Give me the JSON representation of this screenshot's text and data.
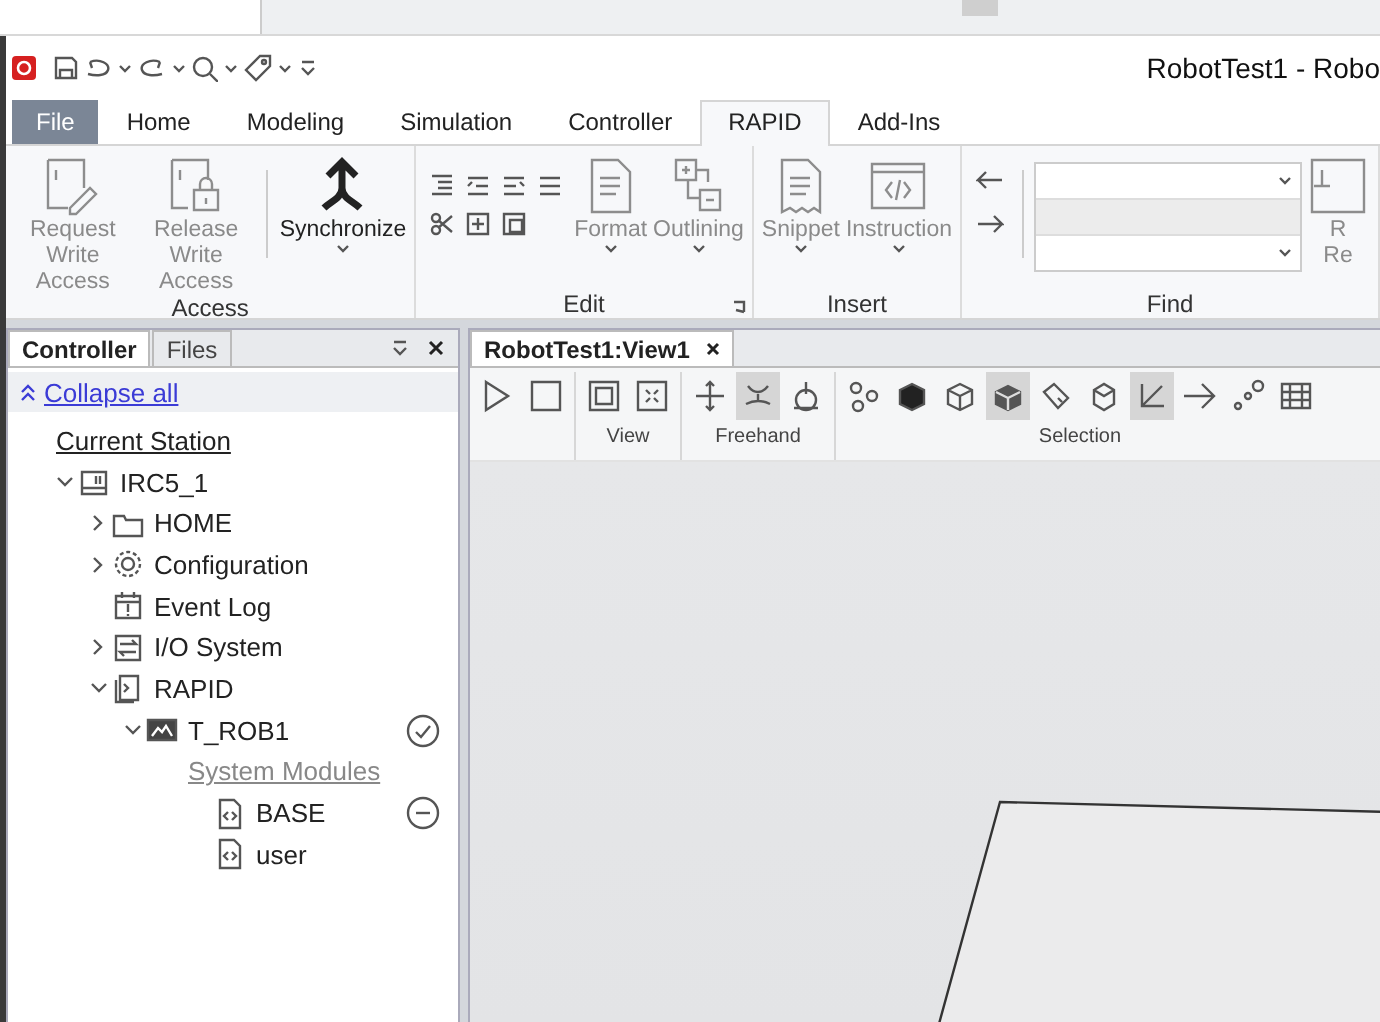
{
  "window": {
    "title": "RobotTest1 - Robo"
  },
  "menu_tabs": [
    {
      "label": "File",
      "kind": "file",
      "selected": false
    },
    {
      "label": "Home",
      "kind": "tab",
      "selected": false
    },
    {
      "label": "Modeling",
      "kind": "tab",
      "selected": false
    },
    {
      "label": "Simulation",
      "kind": "tab",
      "selected": false
    },
    {
      "label": "Controller",
      "kind": "tab",
      "selected": false
    },
    {
      "label": "RAPID",
      "kind": "tab",
      "selected": true
    },
    {
      "label": "Add-Ins",
      "kind": "tab",
      "selected": false
    }
  ],
  "ribbon_groups": [
    {
      "label": "Access",
      "items": [
        {
          "kind": "large",
          "label": "Request Write Access",
          "disabled": true,
          "dropdown": false
        },
        {
          "kind": "large",
          "label": "Release Write Access",
          "disabled": true,
          "dropdown": false
        },
        {
          "kind": "separator"
        },
        {
          "kind": "large",
          "label": "Synchronize",
          "disabled": false,
          "dropdown": true
        }
      ]
    },
    {
      "label": "Edit",
      "launcher": true,
      "items": [
        {
          "kind": "small-tools"
        },
        {
          "kind": "large",
          "label": "Format",
          "disabled": true,
          "dropdown": true
        },
        {
          "kind": "large",
          "label": "Outlining",
          "disabled": true,
          "dropdown": true
        }
      ]
    },
    {
      "label": "Insert",
      "items": [
        {
          "kind": "large",
          "label": "Snippet",
          "disabled": true,
          "dropdown": true
        },
        {
          "kind": "large",
          "label": "Instruction",
          "disabled": true,
          "dropdown": true
        }
      ]
    },
    {
      "label": "Find",
      "items": [
        {
          "kind": "arrows"
        },
        {
          "kind": "separator"
        },
        {
          "kind": "combos"
        },
        {
          "kind": "large",
          "label": "R\nRe",
          "disabled": true,
          "dropdown": false
        }
      ]
    }
  ],
  "panel": {
    "tabs": [
      {
        "label": "Controller",
        "selected": true
      },
      {
        "label": "Files",
        "selected": false
      }
    ],
    "collapse_link": "Collapse all",
    "tree": [
      {
        "label": "Current Station",
        "kind": "station",
        "children": [
          {
            "label": "IRC5_1",
            "kind": "controller",
            "expanded": true,
            "children": [
              {
                "label": "HOME",
                "kind": "folder",
                "expanded": false
              },
              {
                "label": "Configuration",
                "kind": "config",
                "expanded": false
              },
              {
                "label": "Event Log",
                "kind": "log"
              },
              {
                "label": "I/O System",
                "kind": "io",
                "expanded": false
              },
              {
                "label": "RAPID",
                "kind": "rapid",
                "expanded": true,
                "children": [
                  {
                    "label": "T_ROB1",
                    "kind": "task",
                    "expanded": true,
                    "badge": {
                      "kind": "check"
                    },
                    "children": [
                      {
                        "label": "System Modules",
                        "kind": "group",
                        "children": [
                          {
                            "label": "BASE",
                            "kind": "module",
                            "badge": {
                              "kind": "minus"
                            }
                          },
                          {
                            "label": "user",
                            "kind": "module"
                          }
                        ]
                      }
                    ]
                  }
                ]
              }
            ]
          }
        ]
      }
    ]
  },
  "document": {
    "tab": "RobotTest1:View1",
    "toolbar_groups": [
      {
        "buttons": [
          {
            "pressed": false
          },
          {
            "pressed": false
          }
        ]
      },
      {
        "label": "View",
        "buttons": [
          {
            "pressed": false
          },
          {
            "pressed": false
          }
        ]
      },
      {
        "label": "Freehand",
        "buttons": [
          {
            "pressed": false
          },
          {
            "pressed": true
          },
          {
            "pressed": false
          }
        ]
      },
      {
        "label": "Selection",
        "buttons": [
          {
            "pressed": false
          },
          {
            "pressed": false
          },
          {
            "pressed": false
          },
          {
            "pressed": true
          },
          {
            "pressed": false
          },
          {
            "pressed": false
          },
          {
            "pressed": true
          },
          {
            "pressed": false
          },
          {
            "pressed": false
          },
          {
            "pressed": false
          }
        ]
      }
    ]
  }
}
